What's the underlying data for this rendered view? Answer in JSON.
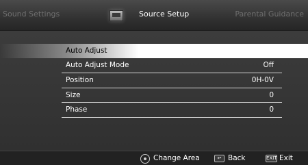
{
  "tabs": {
    "left": "Sound Settings",
    "center": "Source Setup",
    "right": "Parental Guidance"
  },
  "menu": {
    "items": [
      {
        "label": "Auto Adjust",
        "value": ""
      },
      {
        "label": "Auto Adjust Mode",
        "value": "Off"
      },
      {
        "label": "Position",
        "value": "0H-0V"
      },
      {
        "label": "Size",
        "value": "0"
      },
      {
        "label": "Phase",
        "value": "0"
      }
    ]
  },
  "footer": {
    "change_area": "Change Area",
    "back": "Back",
    "exit_key": "EXIT",
    "exit": "Exit",
    "back_key": "↩"
  },
  "colors": {
    "background": "#353535",
    "highlight": "#ffffff",
    "dim_text": "#6f6f6f"
  }
}
